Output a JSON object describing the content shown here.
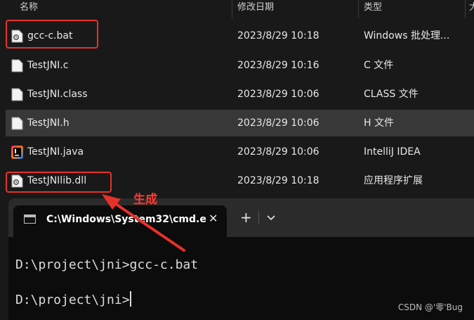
{
  "columns": {
    "name": "名称",
    "modified": "修改日期",
    "type": "类型",
    "size": "大"
  },
  "files": [
    {
      "name": "gcc-c.bat",
      "date": "2023/8/29 10:18",
      "type": "Windows 批处理...",
      "icon": "batch-file-icon"
    },
    {
      "name": "TestJNI.c",
      "date": "2023/8/29 10:16",
      "type": "C 文件",
      "icon": "document-icon"
    },
    {
      "name": "TestJNI.class",
      "date": "2023/8/29 10:06",
      "type": "CLASS 文件",
      "icon": "document-icon"
    },
    {
      "name": "TestJNI.h",
      "date": "2023/8/29 10:06",
      "type": "H 文件",
      "icon": "document-icon"
    },
    {
      "name": "TestJNI.java",
      "date": "2023/8/29 10:06",
      "type": "IntelliJ IDEA",
      "icon": "intellij-icon"
    },
    {
      "name": "TestJNIlib.dll",
      "date": "2023/8/29 10:18",
      "type": "应用程序扩展",
      "icon": "dll-file-icon"
    }
  ],
  "annotation": "生成",
  "terminal": {
    "tab_title": "C:\\Windows\\System32\\cmd.e",
    "close": "✕",
    "add": "+",
    "line1": "D:\\project\\jni>gcc-c.bat",
    "line2": "D:\\project\\jni>"
  },
  "watermark": "CSDN @'零'Bug",
  "colors": {
    "highlight": "#e8312a",
    "selected_row": "#383838",
    "terminal_bg": "#0c0c0c"
  }
}
